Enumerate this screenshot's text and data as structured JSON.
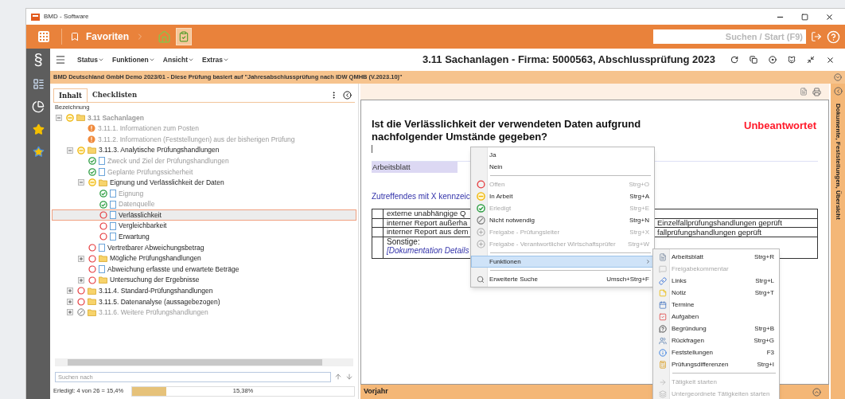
{
  "window": {
    "title": "BMD - Software"
  },
  "toolbar": {
    "favorites": "Favoriten",
    "search": {
      "placeholder": "Suchen / Start (F9)"
    }
  },
  "nav_rail": {
    "section_symbol": "§"
  },
  "menu_bar": {
    "items": [
      "Status",
      "Funktionen",
      "Ansicht",
      "Extras"
    ],
    "title": "3.11 Sachanlagen - Firma: 5000563, Abschlussprüfung 2023"
  },
  "banner": "BMD Deutschland GmbH Demo 2023/01 - Diese Prüfung basiert auf \"Jahresabschlussprüfung nach IDW QMHB (V.2023.10)\"",
  "left_panel": {
    "tabs": [
      {
        "label": "Inhalt",
        "selected": true
      },
      {
        "label": "Checklisten",
        "selected": false
      }
    ],
    "column": "Bezeichnung",
    "tree": [
      {
        "label": "3.11 Sachanlagen",
        "kind": "in_progress",
        "greyed": true,
        "selected": false,
        "expanded": true,
        "children": [
          {
            "label": "3.11.1. Informationen zum Posten",
            "kind": "warning",
            "greyed": true,
            "selected": false
          },
          {
            "label": "3.11.2. Informationen (Feststellungen) aus der bisherigen Prüfung",
            "kind": "warning",
            "greyed": true,
            "selected": false
          },
          {
            "label": "3.11.3. Analytische Prüfungshandlungen",
            "kind": "in_progress",
            "greyed": false,
            "selected": false,
            "expanded": true,
            "children": [
              {
                "label": "Zweck und Ziel der Prüfungshandlungen",
                "kind": "done",
                "greyed": true,
                "selected": false
              },
              {
                "label": "Geplante Prüfungssicherheit",
                "kind": "done",
                "greyed": true,
                "selected": false
              },
              {
                "label": "Eignung und Verlässlichkeit der Daten",
                "kind": "in_progress",
                "greyed": false,
                "selected": false,
                "expanded": true,
                "children": [
                  {
                    "label": "Eignung",
                    "kind": "done",
                    "greyed": true,
                    "selected": false
                  },
                  {
                    "label": "Datenquelle",
                    "kind": "done",
                    "greyed": true,
                    "selected": false
                  },
                  {
                    "label": "Verlässlichkeit",
                    "kind": "open",
                    "greyed": false,
                    "selected": true
                  },
                  {
                    "label": "Vergleichbarkeit",
                    "kind": "open",
                    "greyed": false,
                    "selected": false
                  },
                  {
                    "label": "Erwartung",
                    "kind": "open",
                    "greyed": false,
                    "selected": false
                  }
                ]
              },
              {
                "label": "Vertretbarer Abweichungsbetrag",
                "kind": "open",
                "greyed": false,
                "selected": false
              },
              {
                "label": "Mögliche Prüfungshandlungen",
                "kind": "open",
                "greyed": false,
                "selected": false,
                "expanded": false
              },
              {
                "label": "Abweichung erfasste und erwartete Beträge",
                "kind": "open",
                "greyed": false,
                "selected": false
              },
              {
                "label": "Untersuchung der Ergebnisse",
                "kind": "open",
                "greyed": false,
                "selected": false,
                "expanded": false
              }
            ]
          },
          {
            "label": "3.11.4. Standard-Prüfungshandlungen",
            "kind": "open",
            "greyed": false,
            "selected": false,
            "expanded": false
          },
          {
            "label": "3.11.5. Datenanalyse (aussagebezogen)",
            "kind": "open",
            "greyed": false,
            "selected": false,
            "expanded": false
          },
          {
            "label": "3.11.6. Weitere Prüfungshandlungen",
            "kind": "not_needed",
            "greyed": true,
            "selected": false,
            "expanded": false
          }
        ]
      }
    ],
    "search": {
      "placeholder": "Suchen nach"
    },
    "status": "Erledigt: 4 von 26 = 15,4%",
    "progress": {
      "level": 0.154,
      "label": "15,38%"
    }
  },
  "question": {
    "text": "Ist die Verlässlichkeit der verwendeten Daten aufgrund nachfolgender Umstände gegeben?",
    "state": "Unbeantwortet",
    "worksheet": "Arbeitsblatt",
    "instruction": "Zutreffendes mit X kennzeic",
    "rows": [
      {
        "kind": "option",
        "text": "externe unabhängige Q"
      },
      {
        "kind": "option",
        "text": "interner Report außerha",
        "continuation": "Einzelfallprüfungshandlungen geprüft"
      },
      {
        "kind": "option",
        "text": "interner Report aus dem",
        "continuation": "fallprüfungshandlungen geprüft"
      },
      {
        "kind": "other",
        "text": "Sonstige:",
        "detail": "[Dokumentation Details"
      }
    ]
  },
  "bottom_bar": "Vorjahr",
  "side_strip": "Dokumente, Feststellungen, Übersicht",
  "context_menu": {
    "items": [
      {
        "kind": "command",
        "label": "Ja",
        "disabled": false,
        "selected": false
      },
      {
        "kind": "command",
        "label": "Nein",
        "disabled": false,
        "selected": false
      },
      {
        "kind": "separator"
      },
      {
        "kind": "open",
        "label": "Offen",
        "shortcut": "Strg+O",
        "disabled": true,
        "selected": false
      },
      {
        "kind": "in_progress",
        "label": "In Arbeit",
        "shortcut": "Strg+A",
        "disabled": false,
        "selected": false
      },
      {
        "kind": "done",
        "label": "Erledigt",
        "shortcut": "Strg+E",
        "disabled": true,
        "selected": false
      },
      {
        "kind": "not_needed",
        "label": "Nicht notwendig",
        "shortcut": "Strg+N",
        "disabled": false,
        "selected": false
      },
      {
        "kind": "release",
        "label": "Freigabe - Prüfungsleiter",
        "shortcut": "Strg+X",
        "disabled": true,
        "selected": false
      },
      {
        "kind": "release",
        "label": "Freigabe - Verantwortlicher Wirtschaftsprüfer",
        "shortcut": "Strg+W",
        "disabled": true,
        "selected": false
      },
      {
        "kind": "separator"
      },
      {
        "kind": "submenu",
        "label": "Funktionen",
        "disabled": false,
        "selected": true
      },
      {
        "kind": "separator"
      },
      {
        "kind": "search",
        "label": "Erweiterte Suche",
        "shortcut": "Umsch+Strg+F",
        "disabled": false,
        "selected": false
      }
    ]
  },
  "submenu": {
    "items": [
      {
        "kind": "command",
        "label": "Arbeitsblatt",
        "shortcut": "Strg+R",
        "disabled": false
      },
      {
        "kind": "command",
        "label": "Freigabekommentar",
        "disabled": true
      },
      {
        "kind": "command",
        "label": "Links",
        "shortcut": "Strg+L",
        "disabled": false
      },
      {
        "kind": "command",
        "label": "Notiz",
        "shortcut": "Strg+T",
        "disabled": false
      },
      {
        "kind": "command",
        "label": "Termine",
        "disabled": false
      },
      {
        "kind": "command",
        "label": "Aufgaben",
        "disabled": false
      },
      {
        "kind": "command",
        "label": "Begründung",
        "shortcut": "Strg+B",
        "disabled": false
      },
      {
        "kind": "command",
        "label": "Rückfragen",
        "shortcut": "Strg+G",
        "disabled": false
      },
      {
        "kind": "command",
        "label": "Feststellungen",
        "shortcut": "F3",
        "disabled": false
      },
      {
        "kind": "command",
        "label": "Prüfungsdifferenzen",
        "shortcut": "Strg+I",
        "disabled": false
      },
      {
        "kind": "separator"
      },
      {
        "kind": "command",
        "label": "Tätigkeit starten",
        "disabled": true
      },
      {
        "kind": "command",
        "label": "Untergeordnete Tätigkeiten starten",
        "disabled": true
      }
    ]
  }
}
